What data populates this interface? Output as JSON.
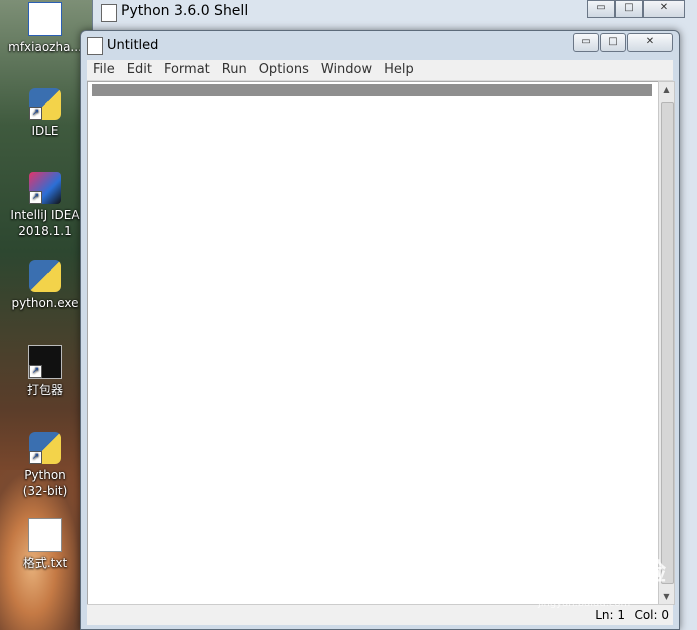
{
  "desktop": {
    "icons": [
      {
        "label": "mfxiaozha...",
        "icon": "word-doc-icon"
      },
      {
        "label": "IDLE",
        "icon": "python-idle-icon"
      },
      {
        "label": "IntelliJ IDEA",
        "label2": "2018.1.1",
        "icon": "intellij-icon"
      },
      {
        "label": "python.exe",
        "icon": "python-icon"
      },
      {
        "label": "打包器",
        "icon": "cmd-icon"
      },
      {
        "label": "Python",
        "label2": "(32-bit)",
        "icon": "python-icon"
      },
      {
        "label": "格式.txt",
        "icon": "text-file-icon"
      }
    ]
  },
  "shell_window": {
    "title": "Python 3.6.0 Shell"
  },
  "editor_window": {
    "title": "Untitled",
    "menu": [
      "File",
      "Edit",
      "Format",
      "Run",
      "Options",
      "Window",
      "Help"
    ],
    "status": {
      "ln": "Ln: 1",
      "col": "Col: 0"
    }
  },
  "window_buttons": {
    "minimize": "▭",
    "maximize": "□",
    "close": "✕"
  },
  "watermark": {
    "text": "Baidu经验",
    "sub": "jingyan.baidu.com"
  },
  "colors": {
    "titlebar": "#cfdbe8",
    "menubar": "#f0f0f0",
    "cursor_line": "#8f8f8f"
  }
}
